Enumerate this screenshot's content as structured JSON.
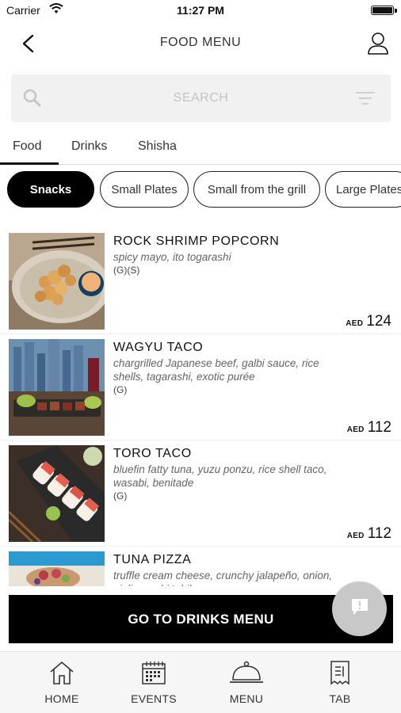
{
  "status_bar": {
    "carrier": "Carrier",
    "time": "11:27 PM"
  },
  "nav": {
    "title": "FOOD MENU",
    "back_icon": "chevron-left-icon",
    "profile_icon": "user-icon"
  },
  "search": {
    "placeholder": "SEARCH",
    "value": ""
  },
  "tabs": [
    {
      "label": "Food",
      "active": true
    },
    {
      "label": "Drinks",
      "active": false
    },
    {
      "label": "Shisha",
      "active": false
    }
  ],
  "categories": [
    {
      "label": "Snacks",
      "active": true
    },
    {
      "label": "Small Plates",
      "active": false
    },
    {
      "label": "Small from the grill",
      "active": false
    },
    {
      "label": "Large Plates",
      "active": false
    }
  ],
  "items": [
    {
      "name": "ROCK SHRIMP POPCORN",
      "description": "spicy mayo, ito togarashi",
      "tags": "(G)(S)",
      "currency": "AED",
      "price": "124"
    },
    {
      "name": "WAGYU TACO",
      "description": "chargrilled Japanese beef, galbi sauce, rice shells, tagarashi, exotic purée",
      "tags": "(G)",
      "currency": "AED",
      "price": "112"
    },
    {
      "name": "TORO TACO",
      "description": "bluefin fatty tuna, yuzu ponzu, rice shell taco, wasabi, benitade",
      "tags": "(G)",
      "currency": "AED",
      "price": "112"
    },
    {
      "name": "TUNA PIZZA",
      "description": "truffle cream cheese, crunchy jalapeño, onion, aioli wasabi tobiko",
      "tags": "",
      "currency": "",
      "price": ""
    }
  ],
  "drinks_button": {
    "label": "GO TO DRINKS MENU"
  },
  "tabbar": [
    {
      "label": "HOME",
      "icon": "home-icon"
    },
    {
      "label": "EVENTS",
      "icon": "calendar-icon"
    },
    {
      "label": "MENU",
      "icon": "cloche-icon"
    },
    {
      "label": "TAB",
      "icon": "receipt-icon"
    }
  ],
  "colors": {
    "accent": "#000000",
    "search_bg": "#f1f1f1",
    "fab": "#c8c8c8",
    "tabbar_bg": "#f6f6f6"
  }
}
